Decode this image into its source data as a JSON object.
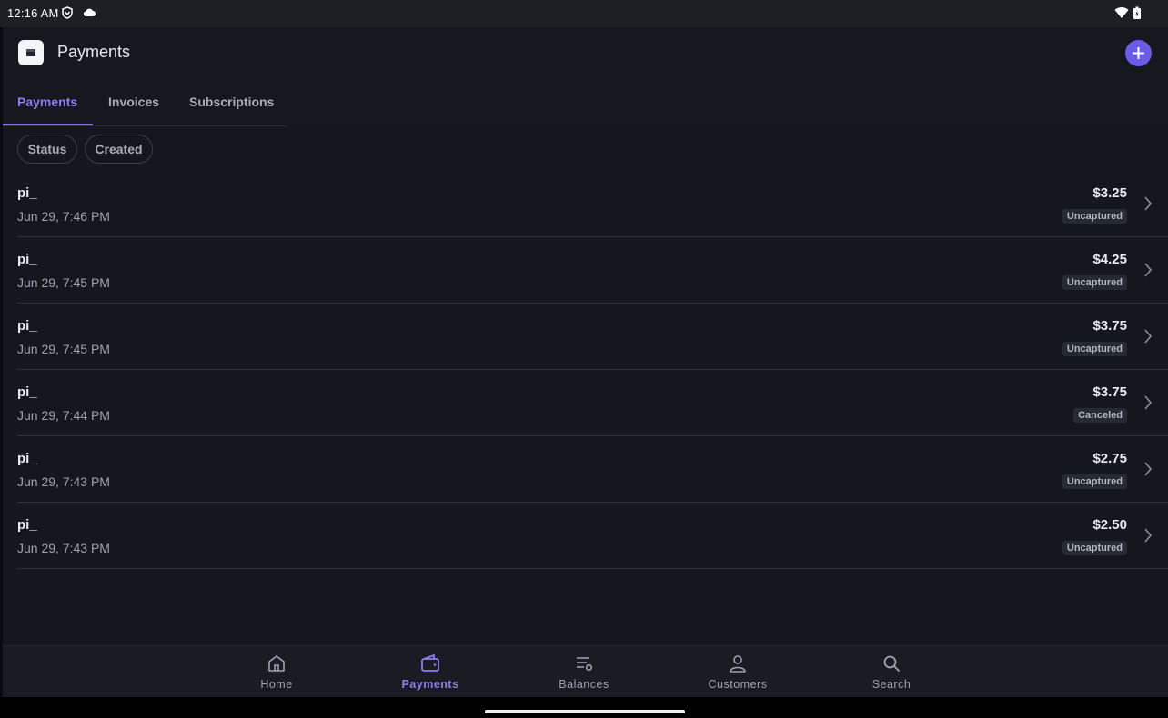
{
  "status_bar": {
    "time": "12:16 AM"
  },
  "app_bar": {
    "title": "Payments"
  },
  "tabs": [
    {
      "label": "Payments",
      "active": true
    },
    {
      "label": "Invoices",
      "active": false
    },
    {
      "label": "Subscriptions",
      "active": false
    }
  ],
  "filters": [
    {
      "label": "Status"
    },
    {
      "label": "Created"
    }
  ],
  "payments": [
    {
      "id": "pi_",
      "date": "Jun 29, 7:46 PM",
      "amount": "$3.25",
      "status": "Uncaptured"
    },
    {
      "id": "pi_",
      "date": "Jun 29, 7:45 PM",
      "amount": "$4.25",
      "status": "Uncaptured"
    },
    {
      "id": "pi_",
      "date": "Jun 29, 7:45 PM",
      "amount": "$3.75",
      "status": "Uncaptured"
    },
    {
      "id": "pi_",
      "date": "Jun 29, 7:44 PM",
      "amount": "$3.75",
      "status": "Canceled"
    },
    {
      "id": "pi_",
      "date": "Jun 29, 7:43 PM",
      "amount": "$2.75",
      "status": "Uncaptured"
    },
    {
      "id": "pi_",
      "date": "Jun 29, 7:43 PM",
      "amount": "$2.50",
      "status": "Uncaptured"
    }
  ],
  "bottom_nav": [
    {
      "label": "Home",
      "icon": "home-icon",
      "active": false
    },
    {
      "label": "Payments",
      "icon": "wallet-icon",
      "active": true
    },
    {
      "label": "Balances",
      "icon": "balances-icon",
      "active": false
    },
    {
      "label": "Customers",
      "icon": "person-icon",
      "active": false
    },
    {
      "label": "Search",
      "icon": "search-icon",
      "active": false
    }
  ],
  "colors": {
    "accent": "#7b6cf0",
    "background": "#15171f",
    "surface": "#1a1c24"
  }
}
